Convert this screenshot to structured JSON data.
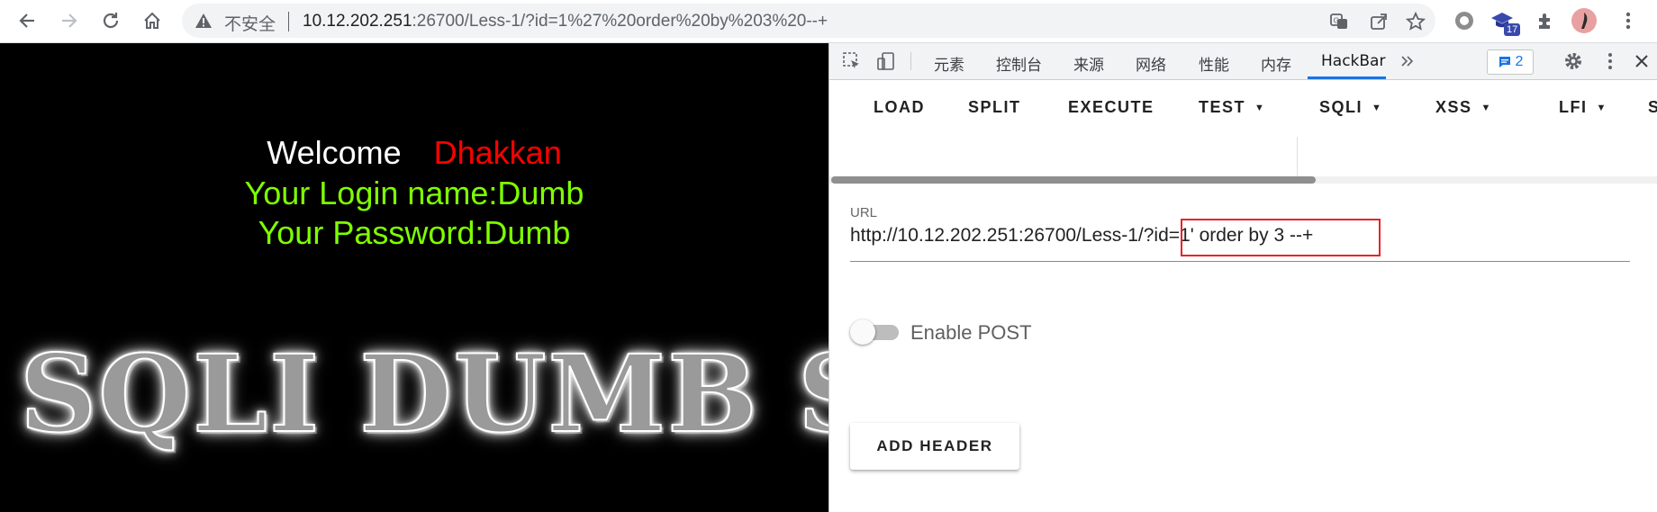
{
  "browser": {
    "security_label": "不安全",
    "url_host": "10.12.202.251",
    "url_rest": ":26700/Less-1/?id=1%27%20order%20by%203%20--+",
    "extension_badge": "17"
  },
  "page": {
    "welcome_label": "Welcome",
    "welcome_name": "Dhakkan",
    "login_line": "Your Login name:Dumb",
    "password_line": "Your Password:Dumb",
    "banner": "SQLI DUMB SERIES"
  },
  "devtools": {
    "tabs": [
      "元素",
      "控制台",
      "来源",
      "网络",
      "性能",
      "内存",
      "HackBar"
    ],
    "active_tab": "HackBar",
    "message_count": "2"
  },
  "hackbar": {
    "menu": [
      "LOAD",
      "SPLIT",
      "EXECUTE",
      "TEST",
      "SQLI",
      "XSS",
      "LFI",
      "S"
    ],
    "url_label": "URL",
    "url_value": "http://10.12.202.251:26700/Less-1/?id=1' order by 3 --+",
    "enable_post_label": "Enable POST",
    "enable_post": false,
    "add_header_label": "ADD HEADER"
  },
  "colors": {
    "welcome_name": "#ff0000",
    "login_text": "#7fff00",
    "highlight": "#e8232a",
    "active_tab_underline": "#1a73e8"
  }
}
